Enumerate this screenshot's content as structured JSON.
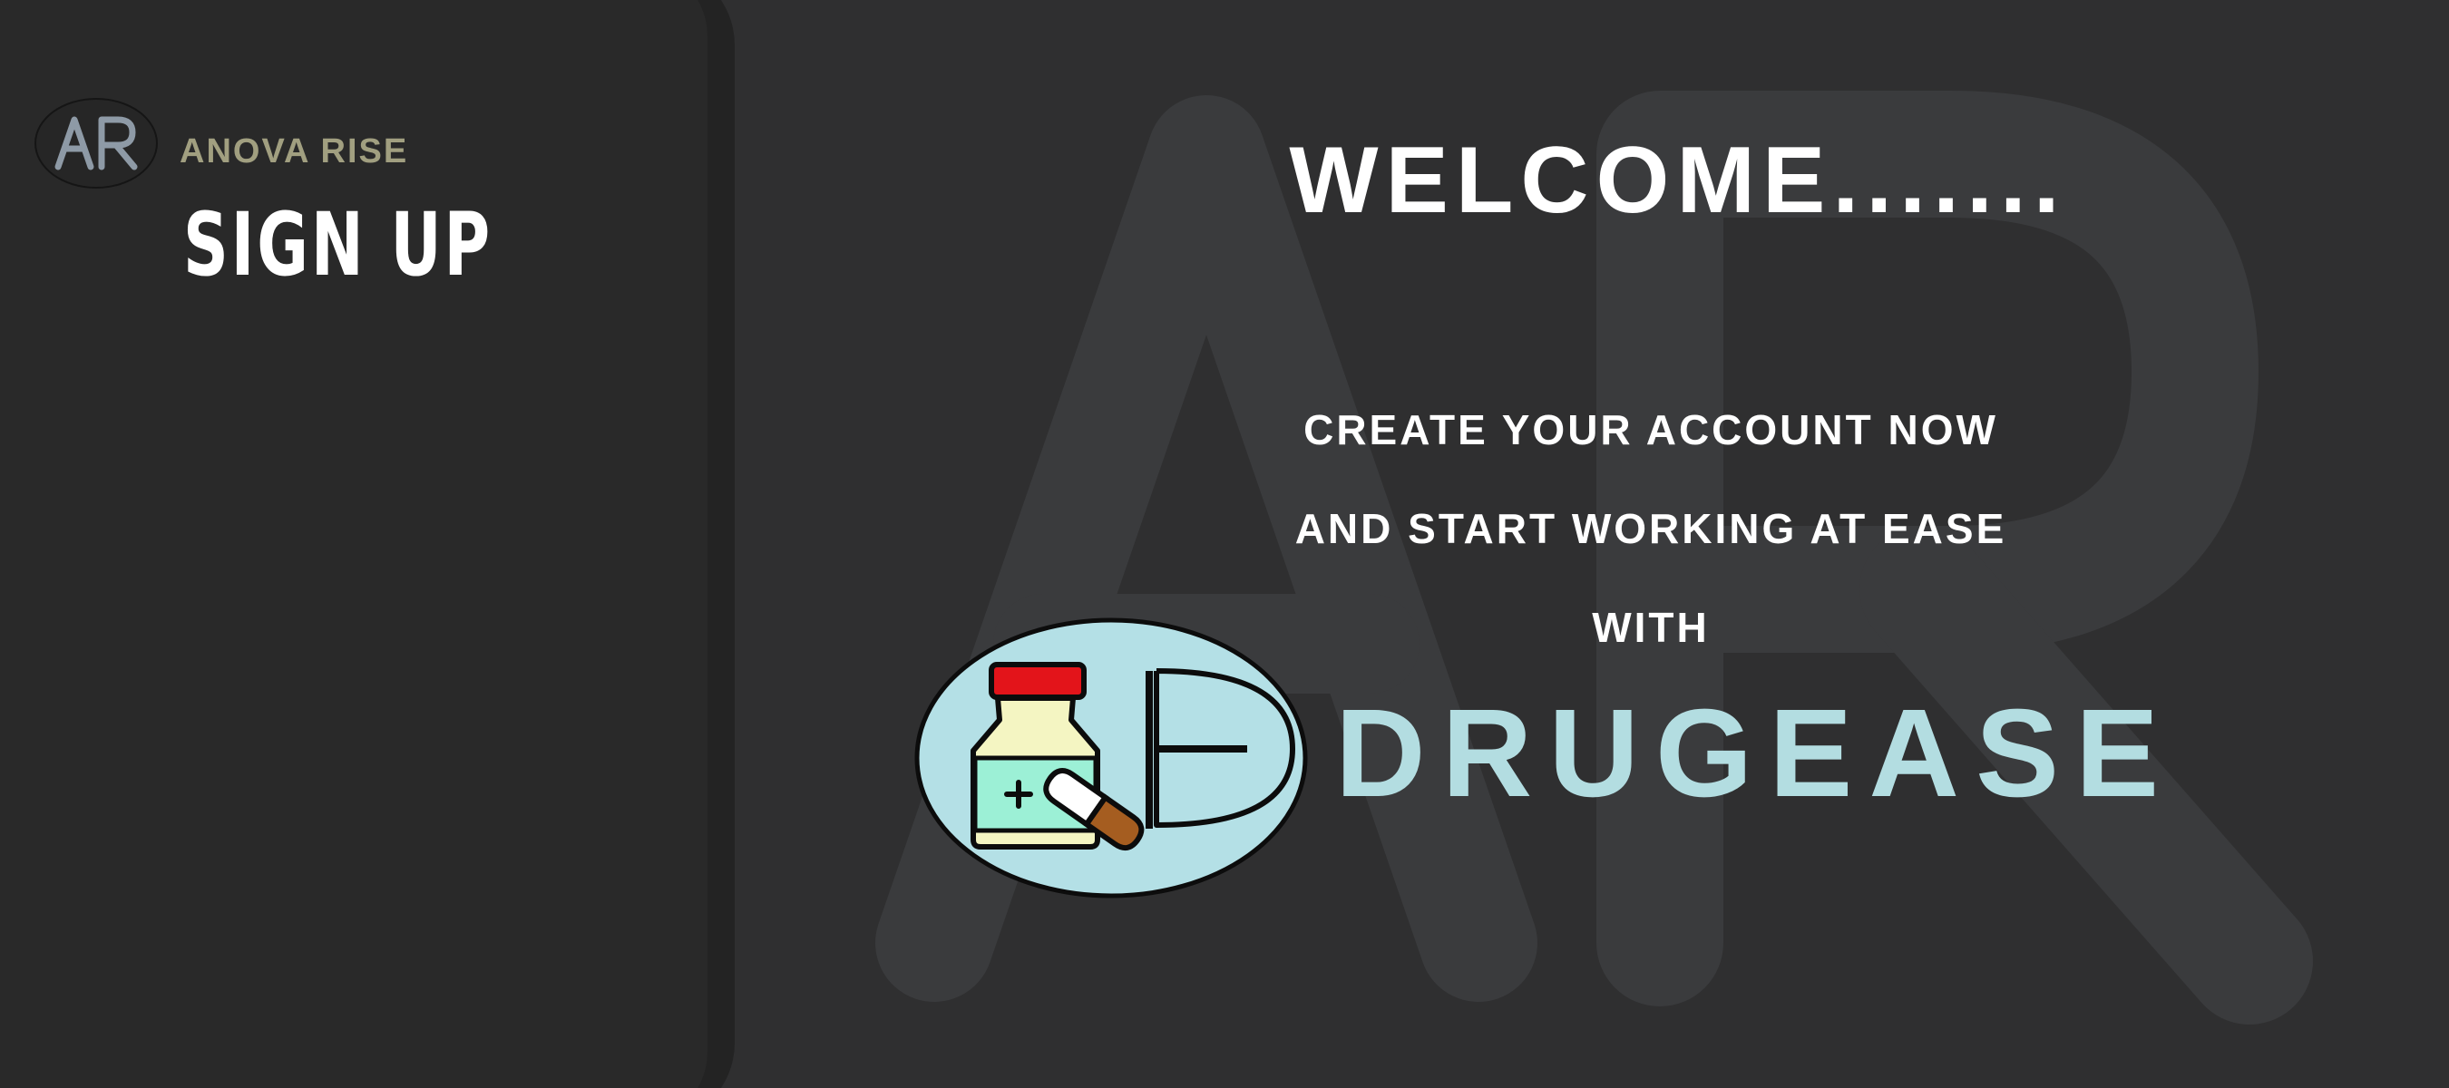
{
  "sidebar": {
    "logo_text": "AR",
    "brand_name": "ANOVA RISE",
    "title": "SIGN UP"
  },
  "hero": {
    "welcome": "WELCOME.......",
    "line1": "CREATE YOUR ACCOUNT NOW",
    "line2": "AND START WORKING AT EASE",
    "line3": "WITH",
    "product_name": "DRUGEASE",
    "watermark_text": "AR"
  },
  "colors": {
    "background": "#2f2f30",
    "panel": "#292929",
    "brand_gold": "#a19f80",
    "product_teal": "#b3dde1",
    "text": "#ffffff"
  },
  "icons": {
    "logo": "ar-monogram-icon",
    "emblem": "medicine-bottle-pill-icon"
  }
}
